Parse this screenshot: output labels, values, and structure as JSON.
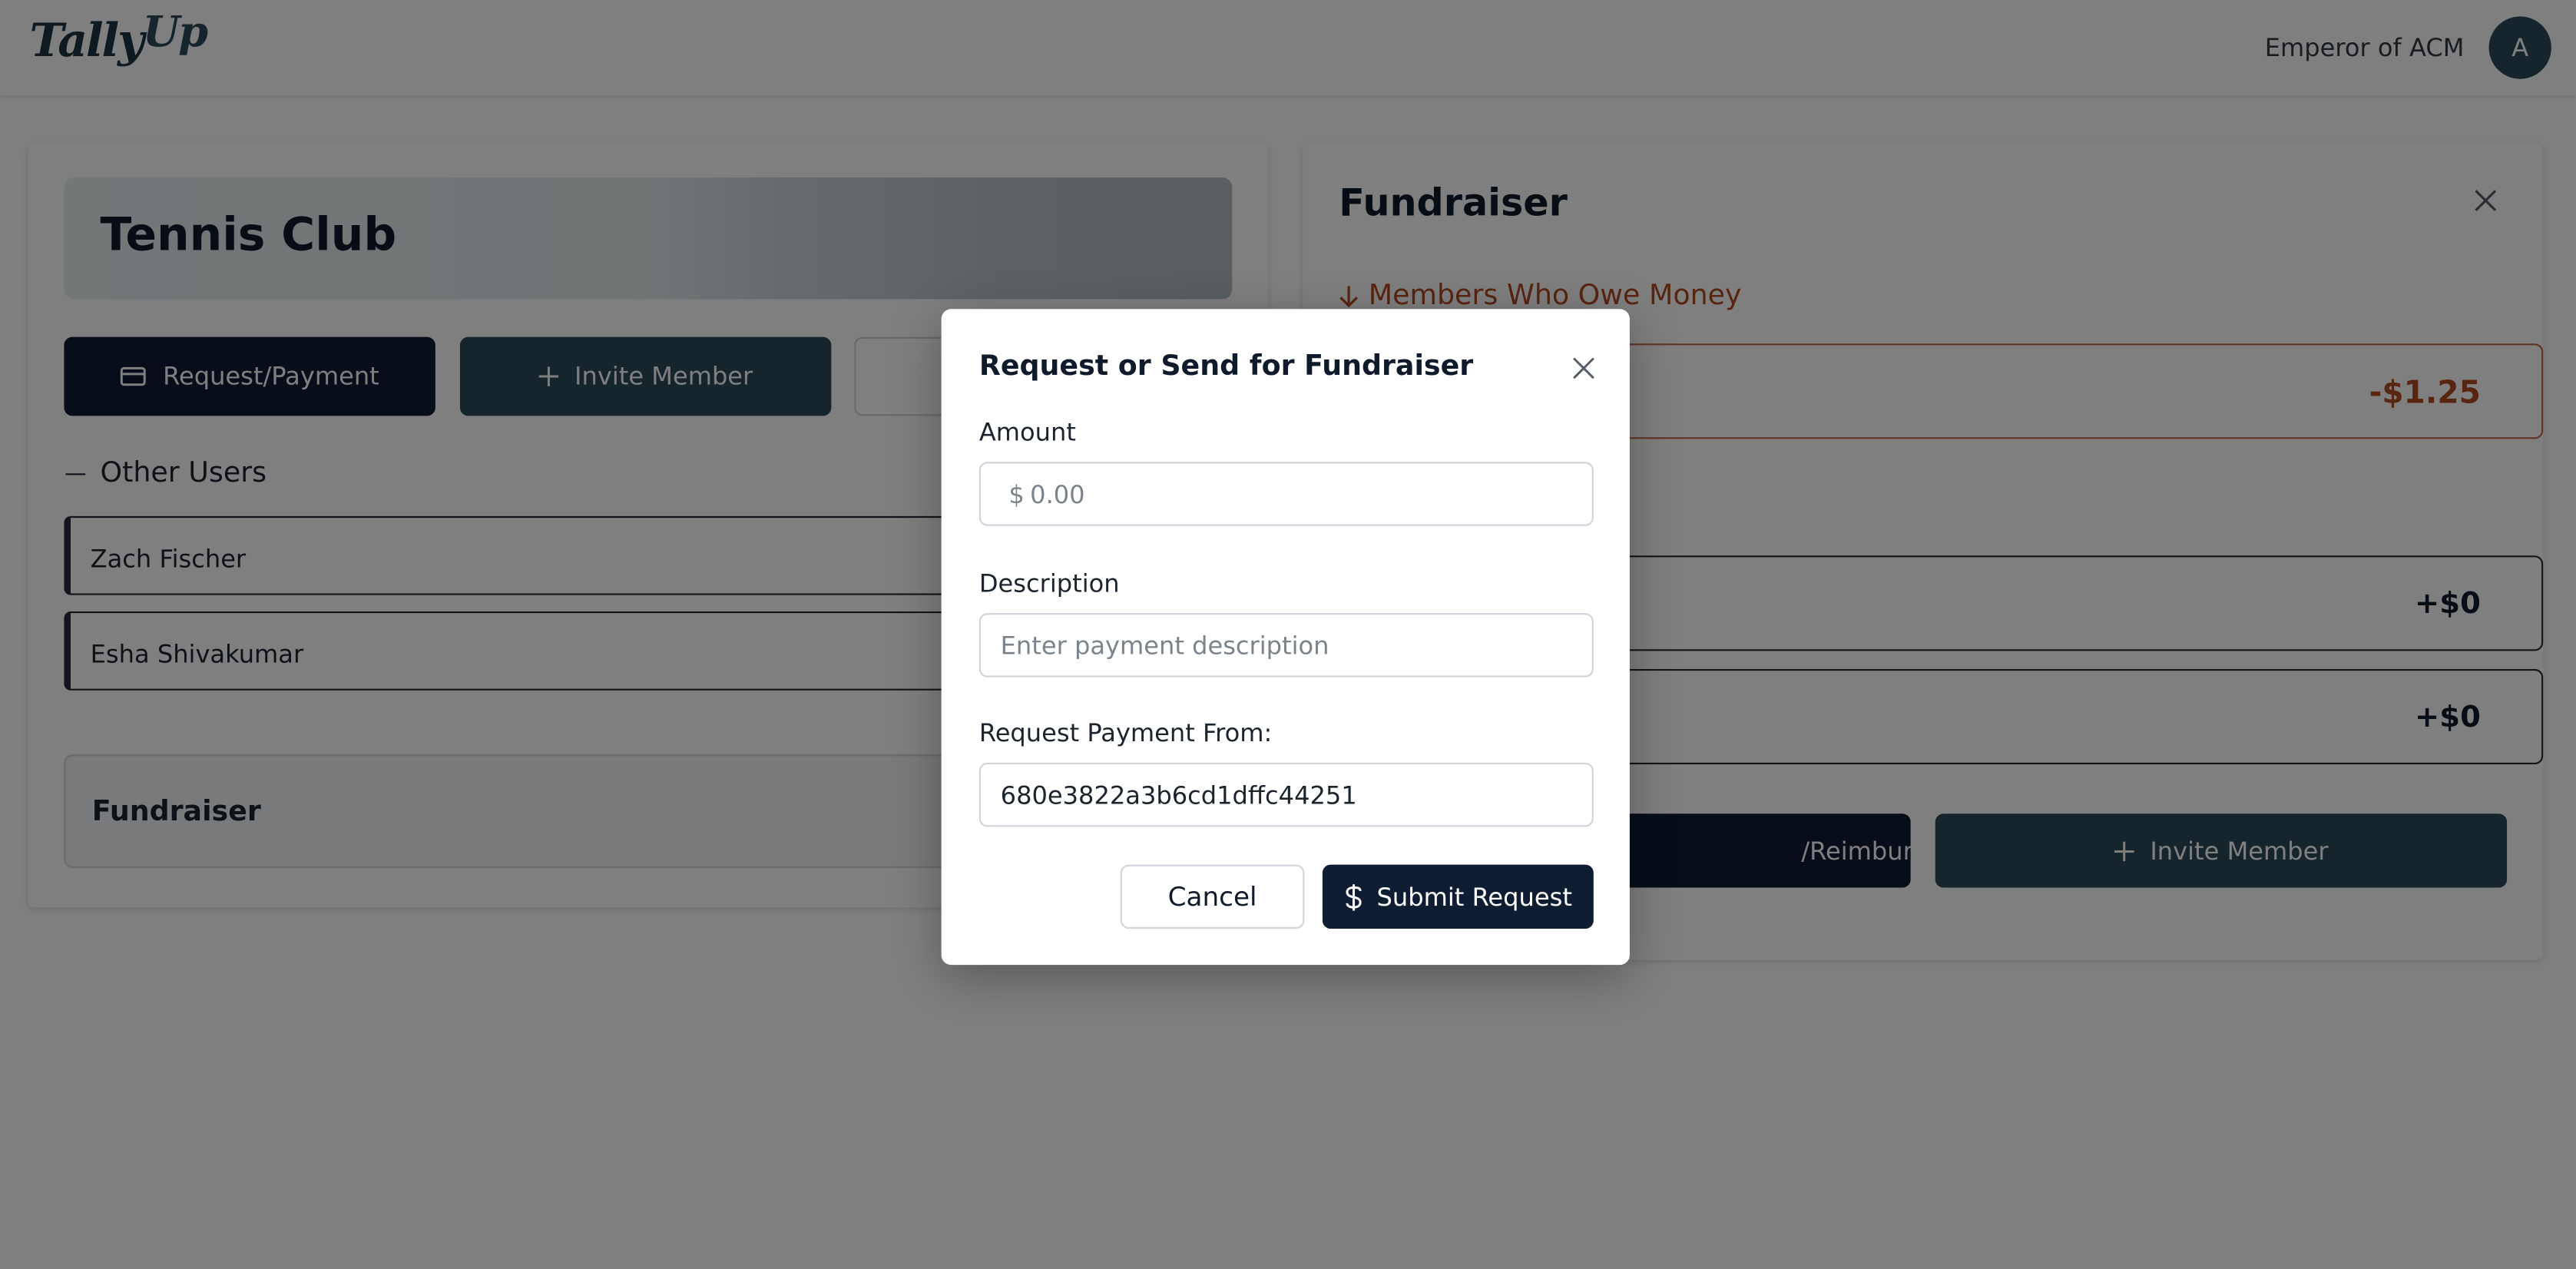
{
  "header": {
    "logo_main": "Tally",
    "logo_accent": "Up",
    "user_name": "Emperor of ACM",
    "avatar_initial": "A"
  },
  "club": {
    "name": "Tennis Club",
    "buttons": {
      "request_payment": "Request/Payment",
      "invite_member": "Invite Member"
    },
    "other_users_heading": "Other Users",
    "members": [
      "Zach Fischer",
      "Esha Shivakumar"
    ],
    "group_tile": "Fundraiser"
  },
  "detail_panel": {
    "title": "Fundraiser",
    "owe_heading": "Members Who Owe Money",
    "owe_amount": "-$1.25",
    "balances": [
      "+$0",
      "+$0"
    ],
    "reimburse_label": "/Reimburse",
    "invite_label": "Invite Member"
  },
  "modal": {
    "title": "Request or Send for Fundraiser",
    "amount_label": "Amount",
    "amount_prefix": "$",
    "amount_placeholder": "0.00",
    "description_label": "Description",
    "description_placeholder": "Enter payment description",
    "request_from_label": "Request Payment From:",
    "request_from_value": "680e3822a3b6cd1dffc44251",
    "cancel_label": "Cancel",
    "submit_label": "Submit Request"
  },
  "colors": {
    "primary_dark": "#0f1d33",
    "slate": "#2d4b58",
    "owe_accent": "#b04a23"
  }
}
